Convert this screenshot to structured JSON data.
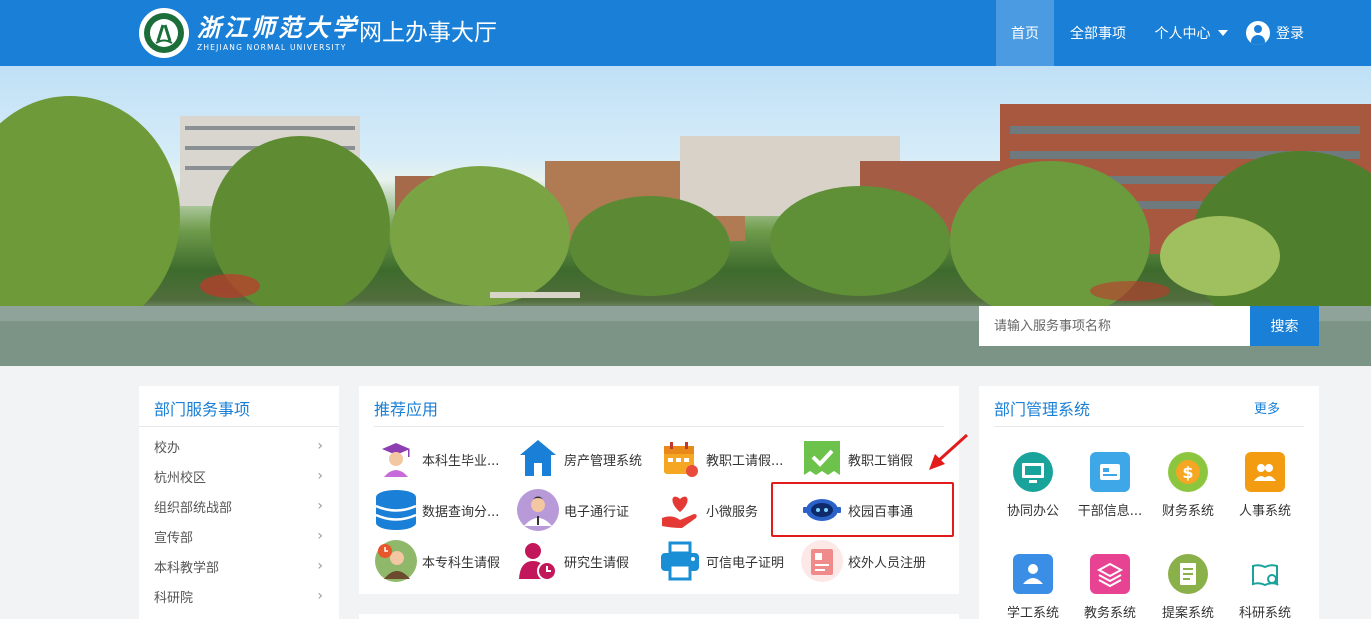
{
  "header": {
    "university_cn": "浙江师范大学",
    "university_en": "ZHEJIANG NORMAL UNIVERSITY",
    "site_title": "网上办事大厅",
    "nav": {
      "home": "首页",
      "all_services": "全部事项",
      "personal_center": "个人中心",
      "login": "登录"
    },
    "brand_color": "#1a7fd6"
  },
  "search": {
    "placeholder": "请输入服务事项名称",
    "button": "搜索"
  },
  "department_services": {
    "title": "部门服务事项",
    "items": [
      "校办",
      "杭州校区",
      "组织部统战部",
      "宣传部",
      "本科教学部",
      "科研院"
    ]
  },
  "recommended_apps": {
    "title": "推荐应用",
    "items": [
      {
        "label": "本科生毕业...",
        "icon": "graduate-icon"
      },
      {
        "label": "房产管理系统",
        "icon": "house-icon"
      },
      {
        "label": "教职工请假...",
        "icon": "calendar-icon"
      },
      {
        "label": "教职工销假",
        "icon": "check-badge-icon"
      },
      {
        "label": "数据查询分...",
        "icon": "database-icon"
      },
      {
        "label": "电子通行证",
        "icon": "person-icon"
      },
      {
        "label": "小微服务",
        "icon": "heart-hand-icon"
      },
      {
        "label": "校园百事通",
        "icon": "robot-icon"
      },
      {
        "label": "本专科生请假",
        "icon": "student-clock-icon"
      },
      {
        "label": "研究生请假",
        "icon": "person-clock-icon"
      },
      {
        "label": "可信电子证明",
        "icon": "printer-icon"
      },
      {
        "label": "校外人员注册",
        "icon": "id-card-icon"
      }
    ]
  },
  "management_systems": {
    "title": "部门管理系统",
    "more": "更多",
    "items": [
      {
        "label": "协同办公",
        "icon": "monitor-icon",
        "color": "#1aa39a"
      },
      {
        "label": "干部信息...",
        "icon": "folder-icon",
        "color": "#3da7e8"
      },
      {
        "label": "财务系统",
        "icon": "coin-icon",
        "color": "#8cc63f"
      },
      {
        "label": "人事系统",
        "icon": "people-icon",
        "color": "#f39c12"
      },
      {
        "label": "学工系统",
        "icon": "student-icon",
        "color": "#3a8ee6"
      },
      {
        "label": "教务系统",
        "icon": "layers-icon",
        "color": "#e84393"
      },
      {
        "label": "提案系统",
        "icon": "clipboard-icon",
        "color": "#8ab04a"
      },
      {
        "label": "科研系统",
        "icon": "book-search-icon",
        "color": "#1aa39a"
      }
    ]
  }
}
